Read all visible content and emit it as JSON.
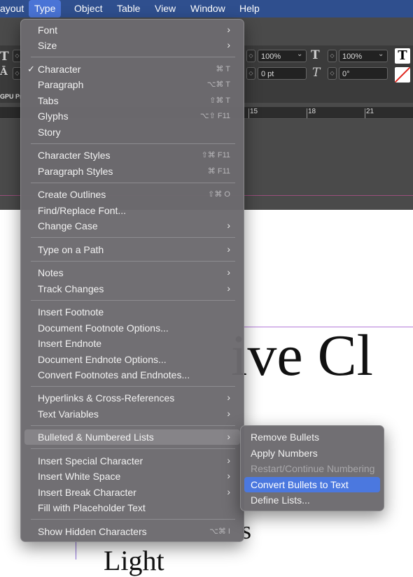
{
  "menubar": {
    "items": [
      "ayout",
      "Type",
      "Object",
      "Table",
      "View",
      "Window",
      "Help"
    ]
  },
  "controls": {
    "scale_x": "100%",
    "scale_y": "100%",
    "baseline": "0 pt",
    "skew": "0°",
    "gpu_label": "GPU Pr"
  },
  "ruler": {
    "marks": [
      "15",
      "18",
      "21"
    ]
  },
  "document": {
    "heading_fragment": "ive Cl",
    "line2_fragment": "s",
    "line3_fragment": "Light"
  },
  "type_menu": {
    "items": [
      {
        "label": "Font",
        "shortcut": "",
        "submenu": true,
        "checked": false
      },
      {
        "label": "Size",
        "shortcut": "",
        "submenu": true,
        "checked": false
      },
      {
        "label": "Character",
        "shortcut": "⌘ T",
        "submenu": false,
        "checked": true
      },
      {
        "label": "Paragraph",
        "shortcut": "⌥⌘ T",
        "submenu": false,
        "checked": false
      },
      {
        "label": "Tabs",
        "shortcut": "⇧⌘ T",
        "submenu": false,
        "checked": false
      },
      {
        "label": "Glyphs",
        "shortcut": "⌥⇧ F11",
        "submenu": false,
        "checked": false
      },
      {
        "label": "Story",
        "shortcut": "",
        "submenu": false,
        "checked": false
      },
      {
        "label": "Character Styles",
        "shortcut": "⇧⌘ F11",
        "submenu": false,
        "checked": false
      },
      {
        "label": "Paragraph Styles",
        "shortcut": "⌘ F11",
        "submenu": false,
        "checked": false
      },
      {
        "label": "Create Outlines",
        "shortcut": "⇧⌘ O",
        "submenu": false,
        "checked": false
      },
      {
        "label": "Find/Replace Font...",
        "shortcut": "",
        "submenu": false,
        "checked": false
      },
      {
        "label": "Change Case",
        "shortcut": "",
        "submenu": true,
        "checked": false
      },
      {
        "label": "Type on a Path",
        "shortcut": "",
        "submenu": true,
        "checked": false
      },
      {
        "label": "Notes",
        "shortcut": "",
        "submenu": true,
        "checked": false
      },
      {
        "label": "Track Changes",
        "shortcut": "",
        "submenu": true,
        "checked": false
      },
      {
        "label": "Insert Footnote",
        "shortcut": "",
        "submenu": false,
        "checked": false
      },
      {
        "label": "Document Footnote Options...",
        "shortcut": "",
        "submenu": false,
        "checked": false
      },
      {
        "label": "Insert Endnote",
        "shortcut": "",
        "submenu": false,
        "checked": false
      },
      {
        "label": "Document Endnote Options...",
        "shortcut": "",
        "submenu": false,
        "checked": false
      },
      {
        "label": "Convert Footnotes and Endnotes...",
        "shortcut": "",
        "submenu": false,
        "checked": false
      },
      {
        "label": "Hyperlinks & Cross-References",
        "shortcut": "",
        "submenu": true,
        "checked": false
      },
      {
        "label": "Text Variables",
        "shortcut": "",
        "submenu": true,
        "checked": false
      },
      {
        "label": "Bulleted & Numbered Lists",
        "shortcut": "",
        "submenu": true,
        "checked": false
      },
      {
        "label": "Insert Special Character",
        "shortcut": "",
        "submenu": true,
        "checked": false
      },
      {
        "label": "Insert White Space",
        "shortcut": "",
        "submenu": true,
        "checked": false
      },
      {
        "label": "Insert Break Character",
        "shortcut": "",
        "submenu": true,
        "checked": false
      },
      {
        "label": "Fill with Placeholder Text",
        "shortcut": "",
        "submenu": false,
        "checked": false
      },
      {
        "label": "Show Hidden Characters",
        "shortcut": "⌥⌘ I",
        "submenu": false,
        "checked": false
      }
    ]
  },
  "lists_submenu": {
    "items": [
      {
        "label": "Remove Bullets",
        "enabled": true,
        "selected": false
      },
      {
        "label": "Apply Numbers",
        "enabled": true,
        "selected": false
      },
      {
        "label": "Restart/Continue Numbering",
        "enabled": false,
        "selected": false
      },
      {
        "label": "Convert Bullets to Text",
        "enabled": true,
        "selected": true
      },
      {
        "label": "Define Lists...",
        "enabled": true,
        "selected": false
      }
    ]
  },
  "colors": {
    "menubar": "#2f4f8e",
    "active_menu": "#4a74d6",
    "selection": "#4b78df"
  }
}
